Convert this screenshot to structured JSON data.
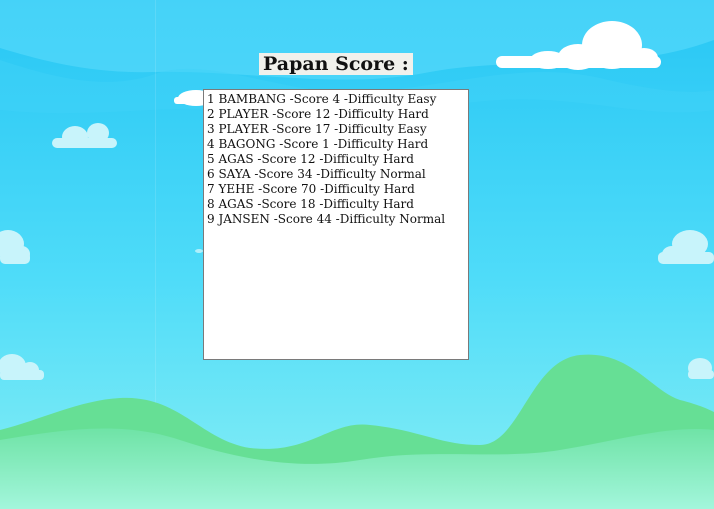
{
  "title": "Papan Score :",
  "scores": [
    "1 BAMBANG -Score 4 -Difficulty Easy",
    "2 PLAYER -Score 12 -Difficulty Hard",
    "3 PLAYER -Score 17 -Difficulty Easy",
    "4 BAGONG -Score 1 -Difficulty Hard",
    "5 AGAS -Score 12 -Difficulty Hard",
    "6 SAYA -Score 34 -Difficulty Normal",
    "7 YEHE -Score 70 -Difficulty Hard",
    "8 AGAS -Score 18 -Difficulty Hard",
    "9 JANSEN -Score 44 -Difficulty Normal"
  ],
  "colors": {
    "sky_top": "#2ec9f5",
    "sky_bottom": "#79ecf8",
    "hill": "#6ee39a",
    "ground": "#9af5d6",
    "cloud": "#ffffff"
  }
}
